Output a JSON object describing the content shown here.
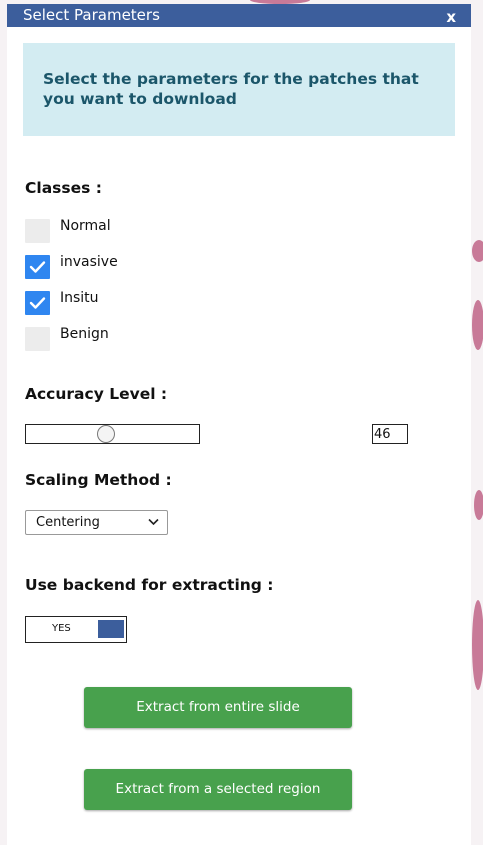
{
  "dialog": {
    "title": "Select Parameters",
    "close_label": "x",
    "info_text": "Select the parameters for the patches that you want to download"
  },
  "classes": {
    "heading": "Classes :",
    "items": [
      {
        "label": "Normal",
        "checked": false
      },
      {
        "label": "invasive",
        "checked": true
      },
      {
        "label": "Insitu",
        "checked": true
      },
      {
        "label": "Benign",
        "checked": false
      }
    ]
  },
  "accuracy": {
    "heading": "Accuracy Level :",
    "value": "46",
    "slider_fraction": 0.46
  },
  "scaling": {
    "heading": "Scaling Method :",
    "selected": "Centering"
  },
  "backend": {
    "heading": "Use backend for extracting :",
    "toggle_label": "YES",
    "enabled": true
  },
  "actions": {
    "extract_entire": "Extract from entire slide",
    "extract_region": "Extract from a selected region"
  },
  "colors": {
    "titlebar": "#3c5e9c",
    "info_background": "#d3ecf2",
    "info_text": "#1b566a",
    "checkbox_checked": "#2f86f0",
    "button_green": "#48a14d"
  }
}
